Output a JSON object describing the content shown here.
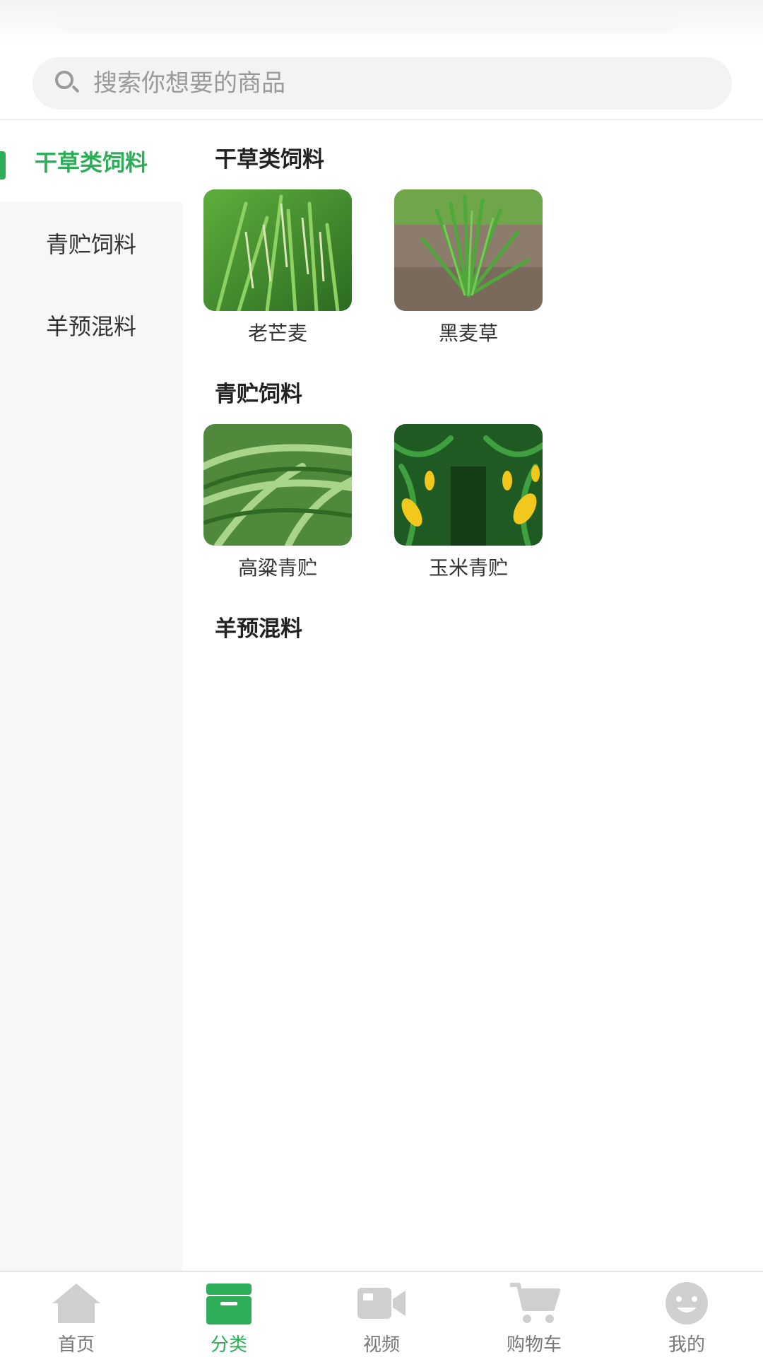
{
  "search": {
    "placeholder": "搜索你想要的商品"
  },
  "sidebar": {
    "items": [
      {
        "label": "干草类饲料",
        "active": true
      },
      {
        "label": "青贮饲料",
        "active": false
      },
      {
        "label": "羊预混料",
        "active": false
      }
    ]
  },
  "sections": [
    {
      "title": "干草类饲料",
      "products": [
        {
          "name": "老芒麦",
          "image": "wheatgrass-photo"
        },
        {
          "name": "黑麦草",
          "image": "ryegrass-photo"
        }
      ]
    },
    {
      "title": "青贮饲料",
      "products": [
        {
          "name": "高粱青贮",
          "image": "sorghum-photo"
        },
        {
          "name": "玉米青贮",
          "image": "corn-photo"
        }
      ]
    },
    {
      "title": "羊预混料",
      "products": []
    }
  ],
  "tabbar": {
    "items": [
      {
        "label": "首页",
        "icon": "home-icon",
        "active": false
      },
      {
        "label": "分类",
        "icon": "category-icon",
        "active": true
      },
      {
        "label": "视频",
        "icon": "video-icon",
        "active": false
      },
      {
        "label": "购物车",
        "icon": "cart-icon",
        "active": false
      },
      {
        "label": "我的",
        "icon": "profile-icon",
        "active": false
      }
    ]
  },
  "colors": {
    "accent": "#2fae5a",
    "inactive_icon": "#cfcfcf",
    "sidebar_bg": "#f7f7f7"
  }
}
